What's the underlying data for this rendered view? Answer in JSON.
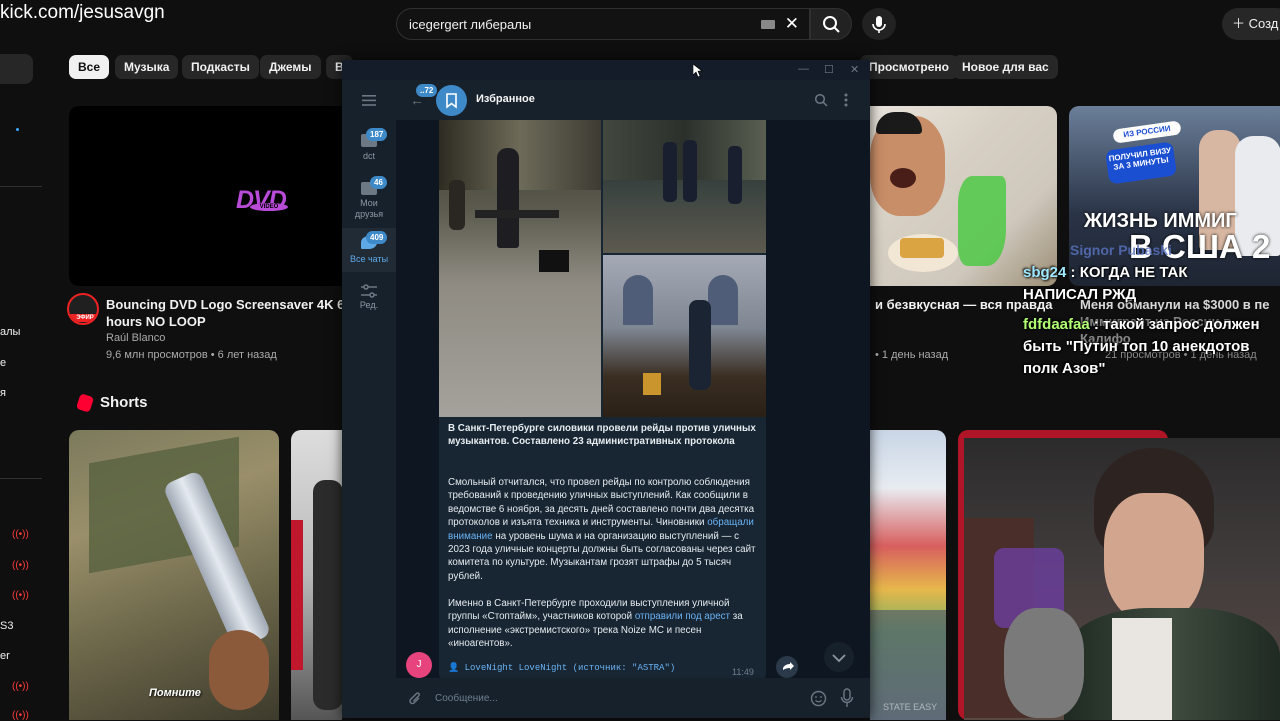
{
  "stream": {
    "url": "kick.com/jesusavgn"
  },
  "youtube": {
    "search": {
      "query": "icegergert либералы"
    },
    "create_label": "Созд",
    "chips": [
      "Все",
      "Музыка",
      "Подкасты",
      "Джемы",
      "В",
      "Просмотрено",
      "Новое для вас"
    ],
    "sidebar_fragments": [
      "алы",
      "е",
      "я",
      "S3",
      "er"
    ],
    "video1": {
      "title_line1": "Bouncing DVD Logo Screensaver 4K 60fps -",
      "title_line2": "hours NO LOOP",
      "channel": "Raúl Blanco",
      "meta": "9,6 млн просмотров • 6 лет назад",
      "badge": "ЭФИР",
      "thumb_logo": "DVD",
      "thumb_sub": "VIDEO"
    },
    "video2": {
      "title": "и безвкусная — вся правда",
      "meta": "• 1 день назад"
    },
    "video3": {
      "title_line1": "Меня обманули на $3000 в пе",
      "title_line2": "Иммигрант из России в Калифо",
      "meta": "21 просмотров • 1 день назад",
      "thumb_sticker_1": "ИЗ РОССИИ",
      "thumb_sticker_2": "ПОЛУЧИЛ ВИЗУ ЗА 3 МИНУТЫ",
      "thumb_headline": "ЖИЗНЬ ИММИГ",
      "thumb_headline2": "В США 2"
    },
    "shorts_title": "Shorts",
    "short1_caption": "Помните",
    "short4_label": "STATE EASY"
  },
  "overlay_chat": [
    {
      "user": "sbg24",
      "text": " : КОГДА НЕ ТАК НАПИСАЛ РЖД"
    },
    {
      "user": "fdfdaafaa",
      "text": " : такой запрос должен быть \"Путин топ 10 анекдотов полк Азов\""
    }
  ],
  "overlay_chat_faded_name": "Signor Pubaski",
  "telegram": {
    "back_badge": "72",
    "chat_title": "Избранное",
    "folders": [
      {
        "label": "dct",
        "badge": "187"
      },
      {
        "label": "Мои друзья",
        "badge": "46"
      },
      {
        "label": "Все чаты",
        "badge": "409"
      },
      {
        "label": "Ред.",
        "badge": ""
      }
    ],
    "message": {
      "headline": "В Санкт-Петербурге силовики провели рейды против уличных музыкантов. Составлено 23 административных протокола",
      "p1_a": "Смольный отчитался, что провел рейды по контролю соблюдения требований к проведению уличных выступлений. Как сообщили в ведомстве 6 ноября, за десять дней составлено почти два десятка протоколов и изъята техника и инструменты. Чиновники ",
      "p1_link": "обращали внимание",
      "p1_b": " на уровень шума и на организацию выступлений — с 2023 года уличные концерты должны быть согласованы через сайт комитета по культуре. Музыкантам грозят штрафы до 5 тысяч рублей.",
      "p2_a": "Именно в Санкт-Петербурге проходили выступления уличной группы «Стоптайм», участников которой ",
      "p2_link": "отправили под арест",
      "p2_b": " за исполнение «экстремистского» трека Noize MC и песен «иноагентов».",
      "signature": "LoveNight LoveNight (источник: \"ASTRA\")",
      "time": "11:49"
    },
    "sender_initial": "J",
    "input_placeholder": "Сообщение..."
  }
}
